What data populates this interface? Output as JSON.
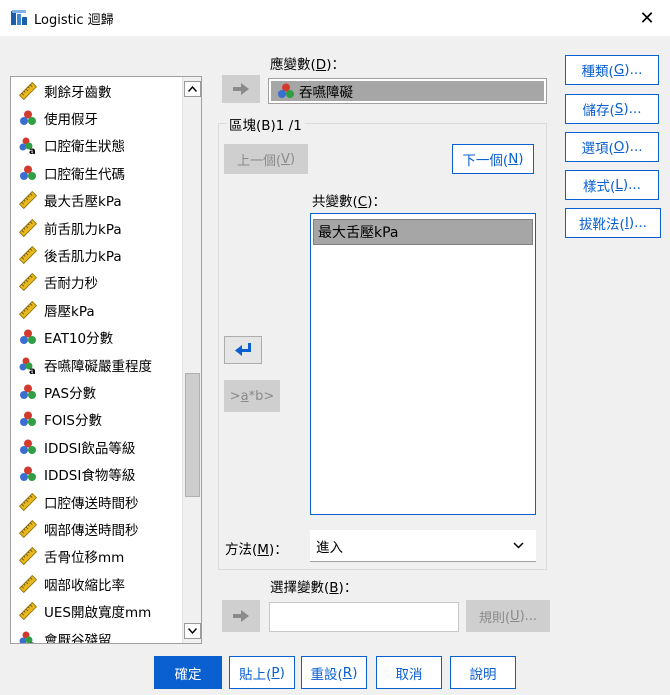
{
  "window": {
    "title": "Logistic 迴歸",
    "close_glyph": "✕"
  },
  "variable_list": {
    "items": [
      {
        "label": "剩餘牙齒數",
        "icon": "scale-ruler-icon"
      },
      {
        "label": "使用假牙",
        "icon": "nominal-icon"
      },
      {
        "label": "口腔衛生狀態",
        "icon": "nominal-string-icon"
      },
      {
        "label": "口腔衛生代碼",
        "icon": "nominal-icon"
      },
      {
        "label": "最大舌壓kPa",
        "icon": "scale-ruler-icon"
      },
      {
        "label": "前舌肌力kPa",
        "icon": "scale-ruler-icon"
      },
      {
        "label": "後舌肌力kPa",
        "icon": "scale-ruler-icon"
      },
      {
        "label": "舌耐力秒",
        "icon": "scale-ruler-icon"
      },
      {
        "label": "唇壓kPa",
        "icon": "scale-ruler-icon"
      },
      {
        "label": "EAT10分數",
        "icon": "nominal-icon"
      },
      {
        "label": "吞嚥障礙嚴重程度",
        "icon": "nominal-string-icon"
      },
      {
        "label": "PAS分數",
        "icon": "nominal-icon"
      },
      {
        "label": "FOIS分數",
        "icon": "nominal-icon"
      },
      {
        "label": "IDDSI飲品等級",
        "icon": "nominal-icon"
      },
      {
        "label": "IDDSI食物等級",
        "icon": "nominal-icon"
      },
      {
        "label": "口腔傳送時間秒",
        "icon": "scale-ruler-icon"
      },
      {
        "label": "咽部傳送時間秒",
        "icon": "scale-ruler-icon"
      },
      {
        "label": "舌骨位移mm",
        "icon": "scale-ruler-icon"
      },
      {
        "label": "咽部收縮比率",
        "icon": "scale-ruler-icon"
      },
      {
        "label": "UES開啟寬度mm",
        "icon": "scale-ruler-icon"
      },
      {
        "label": "會厭谷殘留",
        "icon": "nominal-string-icon"
      }
    ]
  },
  "dependent": {
    "label_pre": "應變數(",
    "label_key": "D",
    "label_post": ")：",
    "value": "吞嚥障礙"
  },
  "block": {
    "label": "區塊(B)1 /1",
    "prev": {
      "pre": "上一個(",
      "key": "V",
      "post": ")"
    },
    "next": {
      "pre": "下一個(",
      "key": "N",
      "post": ")"
    }
  },
  "covariates": {
    "label_pre": "共變數(",
    "label_key": "C",
    "label_post": ")：",
    "items": [
      "最大舌壓kPa"
    ]
  },
  "interaction_button": {
    "pre": ">",
    "key": "a",
    "post": "*b>"
  },
  "method": {
    "label_pre": "方法(",
    "label_key": "M",
    "label_post": ")：",
    "value": "進入"
  },
  "selection": {
    "label_pre": "選擇變數(",
    "label_key": "B",
    "label_post": ")：",
    "value": "",
    "rule": {
      "pre": "規則(",
      "key": "U",
      "post": ")..."
    }
  },
  "side_buttons": [
    {
      "pre": "種類(",
      "key": "G",
      "post": ")..."
    },
    {
      "pre": "儲存(",
      "key": "S",
      "post": ")..."
    },
    {
      "pre": "選項(",
      "key": "O",
      "post": ")..."
    },
    {
      "pre": "樣式(",
      "key": "L",
      "post": ")..."
    },
    {
      "pre": "拔靴法(",
      "key": "I",
      "post": ")..."
    }
  ],
  "footer": {
    "ok": "確定",
    "paste": {
      "pre": "貼上(",
      "key": "P",
      "post": ")"
    },
    "reset": {
      "pre": "重設(",
      "key": "R",
      "post": ")"
    },
    "cancel": "取消",
    "help": "說明"
  },
  "colors": {
    "accent": "#0a5fd1",
    "selected": "#a6a6a6"
  }
}
